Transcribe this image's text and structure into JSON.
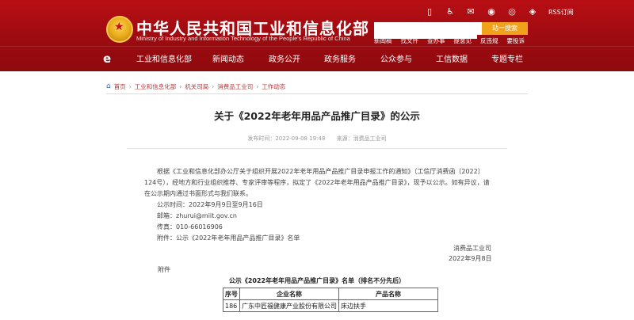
{
  "header": {
    "title": "中华人民共和国工业和信息化部",
    "subtitle": "Ministry of Industry and Information Technology of the People's Republic of China",
    "util": {
      "rss": "RSS订阅"
    },
    "search": {
      "placeholder": "",
      "button": "站一搜索"
    },
    "quick_links": [
      "新闻稿",
      "找文件",
      "查办事",
      "提意见",
      "反违规",
      "要投诉"
    ]
  },
  "nav": {
    "logo": "e",
    "items": [
      "工业和信息化部",
      "新闻动态",
      "政务公开",
      "政务服务",
      "公众参与",
      "工信数据",
      "专题专栏"
    ]
  },
  "breadcrumb": [
    "首页",
    "工业和信息化部",
    "机关司局",
    "消费品工业司",
    "工作动态"
  ],
  "article": {
    "title": "关于《2022年老年用品产品推广目录》的公示",
    "publish_time": "发布时间：2022-09-08 19:48",
    "source": "来源：消费品工业司",
    "paragraph": "根据《工业和信息化部办公厅关于组织开展2022年老年用品产品推广目录申报工作的通知》（工信厅消费函〔2022〕124号），经地方和行业组织推荐、专家评审等程序，拟定了《2022年老年用品产品推广目录》，现予以公示。如有异议，请在公示期内通过书面形式与我们联系。",
    "period": "公示时间：2022年9月9日至9月16日",
    "email": "邮箱：zhurui@miit.gov.cn",
    "fax": "传真：010-66016906",
    "attachment": "附件：公示《2022年老年用品产品推广目录》名单",
    "signature_org": "消费品工业司",
    "signature_date": "2022年9月8日",
    "attach_label": "附件"
  },
  "table": {
    "caption": "公示《2022年老年用品产品推广目录》名单（排名不分先后）",
    "headers": [
      "序号",
      "企业名称",
      "产品名称"
    ],
    "rows": [
      [
        "186",
        "广东中匠福健康产业股份有限公司",
        "床边扶手"
      ]
    ]
  }
}
